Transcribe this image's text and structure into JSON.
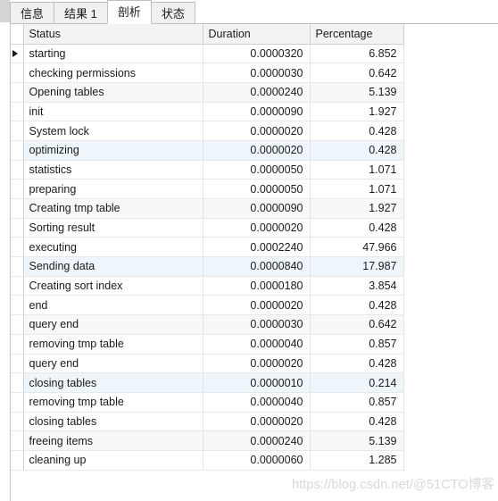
{
  "window": {
    "corner_block": "corner-block"
  },
  "tabs": {
    "items": [
      {
        "label": "信息",
        "name": "tab-info",
        "active": false
      },
      {
        "label": "结果 1",
        "name": "tab-result1",
        "active": false
      },
      {
        "label": "剖析",
        "name": "tab-profile",
        "active": true
      },
      {
        "label": "状态",
        "name": "tab-status",
        "active": false
      }
    ],
    "active_index": 2
  },
  "grid": {
    "columns": [
      {
        "key": "status",
        "label": "Status",
        "align": "left"
      },
      {
        "key": "duration",
        "label": "Duration",
        "align": "right"
      },
      {
        "key": "percentage",
        "label": "Percentage",
        "align": "right"
      }
    ],
    "current_row_index": 0,
    "row_marker_glyph": "▶",
    "rows": [
      {
        "status": "starting",
        "duration": "0.0000320",
        "percentage": "6.852",
        "tint": "plain"
      },
      {
        "status": "checking permissions",
        "duration": "0.0000030",
        "percentage": "0.642",
        "tint": "plain"
      },
      {
        "status": "Opening tables",
        "duration": "0.0000240",
        "percentage": "5.139",
        "tint": "gray"
      },
      {
        "status": "init",
        "duration": "0.0000090",
        "percentage": "1.927",
        "tint": "plain"
      },
      {
        "status": "System lock",
        "duration": "0.0000020",
        "percentage": "0.428",
        "tint": "plain"
      },
      {
        "status": "optimizing",
        "duration": "0.0000020",
        "percentage": "0.428",
        "tint": "blue"
      },
      {
        "status": "statistics",
        "duration": "0.0000050",
        "percentage": "1.071",
        "tint": "plain"
      },
      {
        "status": "preparing",
        "duration": "0.0000050",
        "percentage": "1.071",
        "tint": "plain"
      },
      {
        "status": "Creating tmp table",
        "duration": "0.0000090",
        "percentage": "1.927",
        "tint": "gray"
      },
      {
        "status": "Sorting result",
        "duration": "0.0000020",
        "percentage": "0.428",
        "tint": "plain"
      },
      {
        "status": "executing",
        "duration": "0.0002240",
        "percentage": "47.966",
        "tint": "plain"
      },
      {
        "status": "Sending data",
        "duration": "0.0000840",
        "percentage": "17.987",
        "tint": "blue"
      },
      {
        "status": "Creating sort index",
        "duration": "0.0000180",
        "percentage": "3.854",
        "tint": "plain"
      },
      {
        "status": "end",
        "duration": "0.0000020",
        "percentage": "0.428",
        "tint": "plain"
      },
      {
        "status": "query end",
        "duration": "0.0000030",
        "percentage": "0.642",
        "tint": "gray"
      },
      {
        "status": "removing tmp table",
        "duration": "0.0000040",
        "percentage": "0.857",
        "tint": "plain"
      },
      {
        "status": "query end",
        "duration": "0.0000020",
        "percentage": "0.428",
        "tint": "plain"
      },
      {
        "status": "closing tables",
        "duration": "0.0000010",
        "percentage": "0.214",
        "tint": "blue"
      },
      {
        "status": "removing tmp table",
        "duration": "0.0000040",
        "percentage": "0.857",
        "tint": "plain"
      },
      {
        "status": "closing tables",
        "duration": "0.0000020",
        "percentage": "0.428",
        "tint": "plain"
      },
      {
        "status": "freeing items",
        "duration": "0.0000240",
        "percentage": "5.139",
        "tint": "gray"
      },
      {
        "status": "cleaning up",
        "duration": "0.0000060",
        "percentage": "1.285",
        "tint": "plain"
      }
    ]
  },
  "watermark": {
    "url": "https://blog.csdn.net/",
    "handle": "@51CTO博客",
    "full": "https://blog.csdn.net/@51CTO博客"
  }
}
